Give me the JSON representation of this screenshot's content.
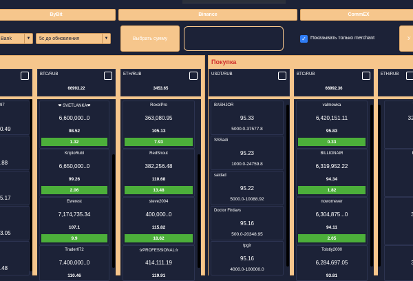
{
  "tabs": {
    "bybit": "ByBit",
    "binance": "Binance",
    "commex": "CommEX",
    "partial_right": ""
  },
  "controls": {
    "bank_select": "Bank",
    "interval_select": "5с до обновления",
    "choose_amount_button": "Выбрать сумму",
    "amount_input_value": "",
    "merchant_only_label": "Показывать только merchant",
    "merchant_only_checked": true,
    "partial_button": "У"
  },
  "buy_panel": {
    "title": "Покупка"
  },
  "sell_panel": {
    "pairs": [
      {
        "name": "",
        "price": ""
      },
      {
        "name": "BTC/RUB",
        "price": "66993.22"
      },
      {
        "name": "ETH/RUB",
        "price": "3453.65"
      }
    ],
    "columns": [
      {
        "cards": [
          {
            "name": "97",
            "amount": "0.49",
            "price": "",
            "badge": ""
          },
          {
            "name": "",
            "amount": ".88",
            "price": "",
            "badge": ""
          },
          {
            "name": "",
            "amount": "5.17",
            "price": "",
            "badge": ""
          },
          {
            "name": "",
            "amount": "3.05",
            "price": "",
            "badge": ""
          },
          {
            "name": "",
            "amount": ".48",
            "price": "",
            "badge": ""
          }
        ]
      },
      {
        "cards": [
          {
            "name": "❤ SVETLANKA❤",
            "amount": "6,600,000..0",
            "price": "98.52",
            "badge": "1.32"
          },
          {
            "name": "KriptoRubl",
            "amount": "6,650,000..0",
            "price": "99.26",
            "badge": "2.06"
          },
          {
            "name": "Ewerest",
            "amount": "7,174,735.34",
            "price": "107.1",
            "badge": "9.9"
          },
          {
            "name": "Trader072",
            "amount": "7,400,000..0",
            "price": "110.46",
            "badge": ""
          }
        ]
      },
      {
        "cards": [
          {
            "name": "RoxelPro",
            "amount": "363,080.95",
            "price": "105.13",
            "badge": "7.93"
          },
          {
            "name": "RedSnout",
            "amount": "382,256.48",
            "price": "110.68",
            "badge": "13.48"
          },
          {
            "name": "steve2004",
            "amount": "400,000..0",
            "price": "115.82",
            "badge": "18.62"
          },
          {
            "name": "✰PROFESSIONAL✰",
            "amount": "414,111.19",
            "price": "119.91",
            "badge": ""
          }
        ]
      }
    ]
  },
  "buy_pairs": [
    {
      "name": "USDT/RUB",
      "price": ""
    },
    {
      "name": "BTC/RUB",
      "price": "66992.36"
    },
    {
      "name": "ETH/RUB",
      "price": ""
    }
  ],
  "buy_columns": [
    {
      "cards": [
        {
          "name": "BASHJOR",
          "price": "95.33",
          "range": "5000.0-37577.8"
        },
        {
          "name": "SSSadi",
          "price": "95.23",
          "range": "1000.0-24759.8"
        },
        {
          "name": "saidad",
          "price": "95.22",
          "range": "5000.0-10088.92"
        },
        {
          "name": "Doctor Firdavs",
          "price": "95.16",
          "range": "500.0-20348.95"
        },
        {
          "name": "tpgir",
          "price": "95.16",
          "range": "4000.0-100000.0"
        }
      ]
    },
    {
      "cards": [
        {
          "name": "valmowka",
          "amount": "6,420,151.11",
          "price": "95.83",
          "badge": "0.33"
        },
        {
          "name": "BILLIONAIR",
          "amount": "6,319,952.22",
          "price": "94.34",
          "badge": "1.82"
        },
        {
          "name": "nowornever",
          "amount": "6,304,875...0",
          "price": "94.11",
          "badge": "2.05"
        },
        {
          "name": "Tolstiy2000",
          "amount": "6,284,697.05",
          "price": "93.81",
          "badge": ""
        }
      ]
    },
    {
      "cards": [
        {
          "name": "To",
          "amount": "323",
          "price": "",
          "badge": ""
        },
        {
          "name": "Be",
          "amount": "3",
          "price": "",
          "badge": ""
        },
        {
          "name": "H",
          "amount": "31",
          "price": "",
          "badge": ""
        },
        {
          "name": "",
          "amount": "31",
          "price": "",
          "badge": ""
        }
      ]
    }
  ]
}
